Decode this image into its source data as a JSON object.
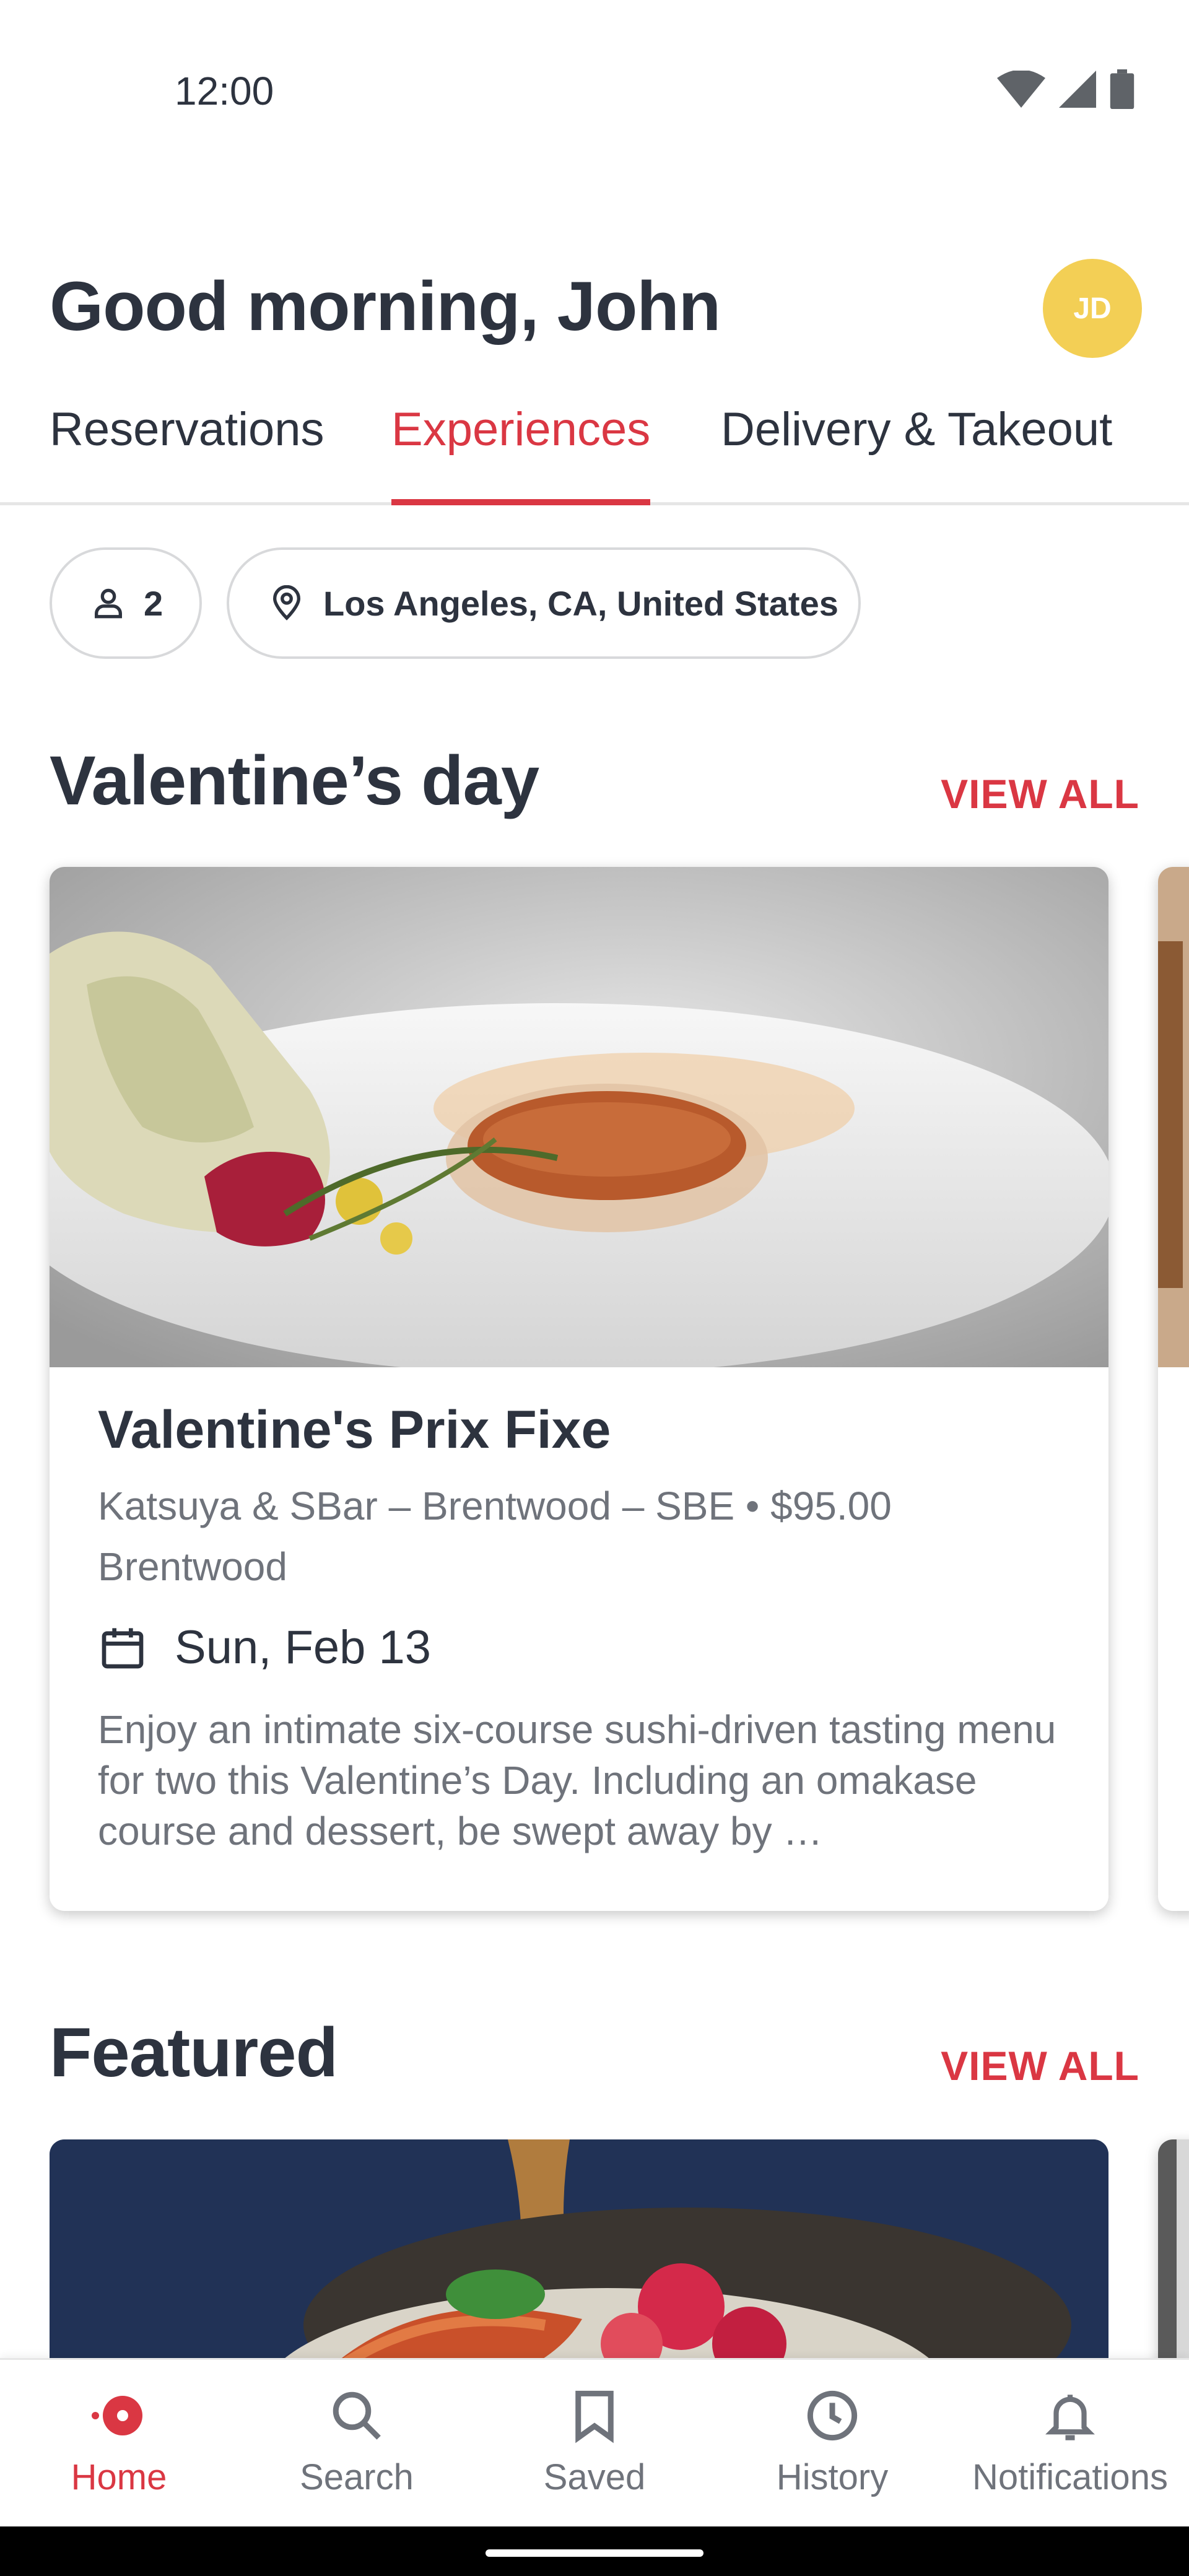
{
  "status_bar": {
    "time": "12:00"
  },
  "header": {
    "greeting": "Good morning, John",
    "avatar_initials": "JD"
  },
  "tabs": [
    {
      "label": "Reservations",
      "active": false
    },
    {
      "label": "Experiences",
      "active": true
    },
    {
      "label": "Delivery & Takeout",
      "active": false
    }
  ],
  "filters": {
    "guests": "2",
    "location": "Los Angeles, CA, United States"
  },
  "sections": {
    "valentines": {
      "title": "Valentine’s day",
      "view_all": "VIEW ALL",
      "card": {
        "title": "Valentine's Prix Fixe",
        "subtitle": "Katsuya & SBar – Brentwood – SBE • $95.00",
        "neighborhood": "Brentwood",
        "date": "Sun, Feb 13",
        "description": "Enjoy an intimate six-course sushi-driven tasting menu for two this Valentine’s Day. Including an omakase course and dessert, be swept away by …"
      }
    },
    "featured": {
      "title": "Featured",
      "view_all": "VIEW ALL"
    }
  },
  "bottom_nav": [
    {
      "label": "Home",
      "icon": "home-dot-icon",
      "active": true
    },
    {
      "label": "Search",
      "icon": "search-icon",
      "active": false
    },
    {
      "label": "Saved",
      "icon": "bookmark-icon",
      "active": false
    },
    {
      "label": "History",
      "icon": "clock-icon",
      "active": false
    },
    {
      "label": "Notifications",
      "icon": "bell-icon",
      "active": false
    }
  ],
  "colors": {
    "accent": "#da3743",
    "text": "#2d333f",
    "muted": "#6f737b",
    "avatar": "#f3cf55"
  }
}
